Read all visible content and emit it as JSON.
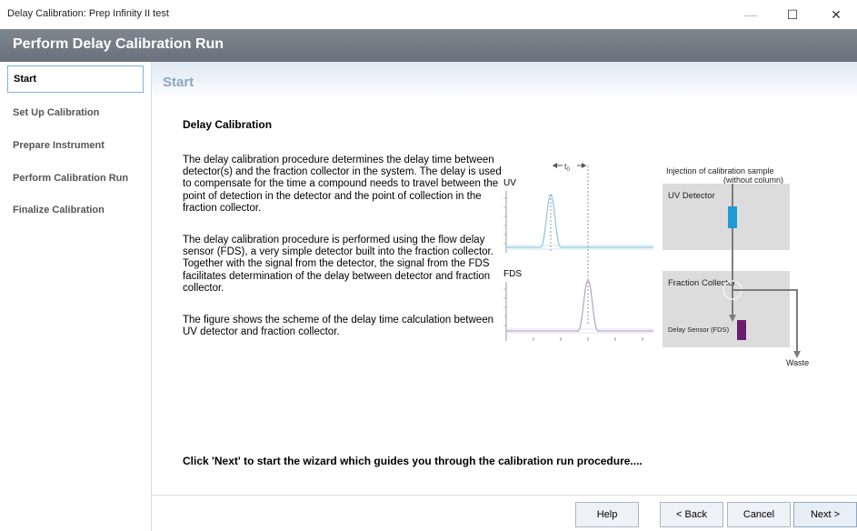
{
  "window": {
    "title": "Delay Calibration: Prep Infinity II test",
    "minimize": "—",
    "maximize": "☐",
    "close": "✕"
  },
  "header": {
    "title": "Perform Delay Calibration Run"
  },
  "sidebar": {
    "items": [
      {
        "label": "Start",
        "active": true
      },
      {
        "label": "Set Up Calibration",
        "active": false
      },
      {
        "label": "Prepare Instrument",
        "active": false
      },
      {
        "label": "Perform Calibration Run",
        "active": false
      },
      {
        "label": "Finalize Calibration",
        "active": false
      }
    ]
  },
  "content": {
    "heading": "Start",
    "section_title": "Delay Calibration",
    "paragraphs": [
      "The delay calibration procedure determines the delay time between detector(s) and the fraction collector in the system. The delay is used to compensate for the time a compound needs to travel between the point of detection in the detector and the point of collection in the fraction collector.",
      "The delay calibration procedure is performed using the flow delay sensor (FDS), a very simple detector built into the fraction collector. Together with the signal from the detector, the signal from the FDS facilitates determination of the delay between detector and fraction collector.",
      "The figure shows the scheme of the delay time calculation between UV detector and fraction collector."
    ],
    "bottom_note": "Click 'Next' to start the wizard which guides you through the calibration run procedure....",
    "figure": {
      "uv_label": "UV",
      "fds_label": "FDS",
      "t0_label": "t",
      "t0_sub": "0",
      "injection_label_1": "Injection of calibration sample",
      "injection_label_2": "(without column)",
      "uv_detector": "UV Detector",
      "fraction_collector": "Fraction Collector",
      "delay_sensor": "Delay Sensor (FDS)",
      "waste": "Waste",
      "colors": {
        "uv_trace": "#8ec7e6",
        "fds_trace": "#b7a0cc",
        "uv_sensor": "#1f9ad8",
        "fds_sensor": "#6a1f6e",
        "box_fill": "#dcdcdc",
        "flow_line": "#7d7d7d"
      }
    }
  },
  "footer": {
    "help": "Help",
    "back": "< Back",
    "cancel": "Cancel",
    "next": "Next >"
  }
}
